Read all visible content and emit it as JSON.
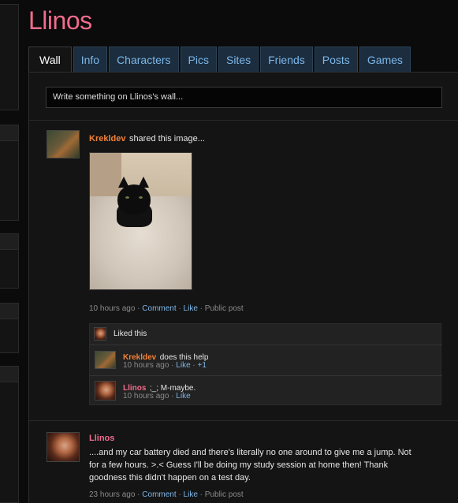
{
  "profile": {
    "name": "Llinos"
  },
  "tabs": [
    {
      "label": "Wall"
    },
    {
      "label": "Info"
    },
    {
      "label": "Characters"
    },
    {
      "label": "Pics"
    },
    {
      "label": "Sites"
    },
    {
      "label": "Friends"
    },
    {
      "label": "Posts"
    },
    {
      "label": "Games"
    }
  ],
  "wall_input": {
    "placeholder": "Write something on Llinos's wall..."
  },
  "posts": [
    {
      "author": "Krekldev",
      "action": "shared this image...",
      "time": "10 hours ago",
      "comment_label": "Comment",
      "like_label": "Like",
      "visibility": "Public post",
      "liked_text": "Liked this",
      "comments": [
        {
          "author": "Krekldev",
          "text": "does this help",
          "time": "10 hours ago",
          "like_label": "Like",
          "plus": "+1"
        },
        {
          "author": "Llinos",
          "text": ";_; M-maybe.",
          "time": "10 hours ago",
          "like_label": "Like"
        }
      ]
    },
    {
      "author": "Llinos",
      "text": "....and my car battery died and there's literally no one around to give me a jump. Not for a few hours. >.< Guess I'll be doing my study session at home then! Thank goodness this didn't happen on a test day.",
      "time": "23 hours ago",
      "comment_label": "Comment",
      "like_label": "Like",
      "visibility": "Public post"
    }
  ],
  "colors": {
    "accent_pink": "#f06c8c",
    "accent_orange": "#f0823a",
    "link_blue": "#7db6e8",
    "background": "#0b0b0b"
  }
}
